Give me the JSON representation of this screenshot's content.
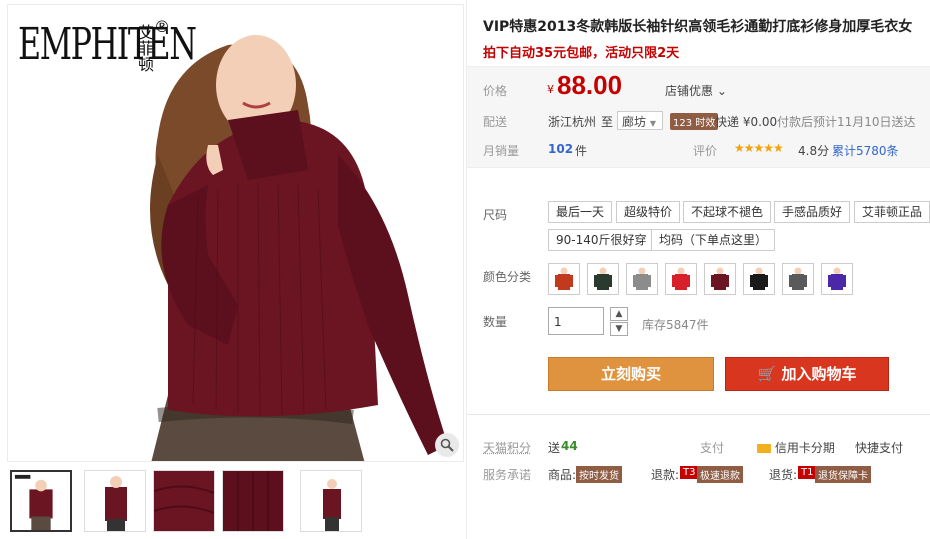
{
  "brand": {
    "name": "EMPHITEN",
    "cn": "艾菲顿",
    "reg": "®"
  },
  "product": {
    "title": "VIP特惠2013冬款韩版长袖针织高领毛衫通勤打底衫修身加厚毛衣女",
    "promo": "拍下自动35元包邮，活动只限2天"
  },
  "price": {
    "label": "价格",
    "currency": "¥",
    "value": "88.00",
    "shop_discount": "店铺优惠",
    "chevron": "chevron-down-icon"
  },
  "shipping": {
    "label": "配送",
    "from": "浙江杭州",
    "to_word": "至",
    "to": "廊坊",
    "badge": "123 时效",
    "method": "快递 ¥0.00",
    "eta": "付款后预计11月10日送达"
  },
  "sales": {
    "label": "月销量",
    "value": "102",
    "unit": "件",
    "rating_label": "评价",
    "stars": "★★★★★",
    "score": "4.8分",
    "total": "累计5780条"
  },
  "size": {
    "label": "尺码",
    "options": [
      "最后一天",
      "超级特价",
      "不起球不褪色",
      "手感品质好",
      "艾菲顿正品",
      "90-140斤很好穿",
      "均码（下单点这里）"
    ]
  },
  "color": {
    "label": "颜色分类",
    "swatch_colors": [
      "#c23a1e",
      "#2a3a2e",
      "#8c8c8c",
      "#d8202a",
      "#6b1422",
      "#1a1a1a",
      "#5a5a5a",
      "#4a28a8"
    ]
  },
  "quantity": {
    "label": "数量",
    "value": "1",
    "stock": "库存5847件"
  },
  "buttons": {
    "buy": "立刻购买",
    "cart": "加入购物车"
  },
  "points": {
    "label": "天猫积分",
    "prefix": "送",
    "value": "44",
    "pay_label": "支付",
    "credit": "信用卡分期",
    "quick": "快捷支付"
  },
  "service": {
    "label": "服务承诺",
    "goods": "商品:",
    "goods_badge": "按时发货",
    "refund": "退款:",
    "refund_code": "T3",
    "refund_badge": "极速退款",
    "return": "退货:",
    "return_code": "T1",
    "return_badge": "退货保障卡"
  },
  "colors": {
    "accent_red": "#c40000",
    "buy_orange": "#e0933f",
    "cart_red": "#d8361e"
  }
}
